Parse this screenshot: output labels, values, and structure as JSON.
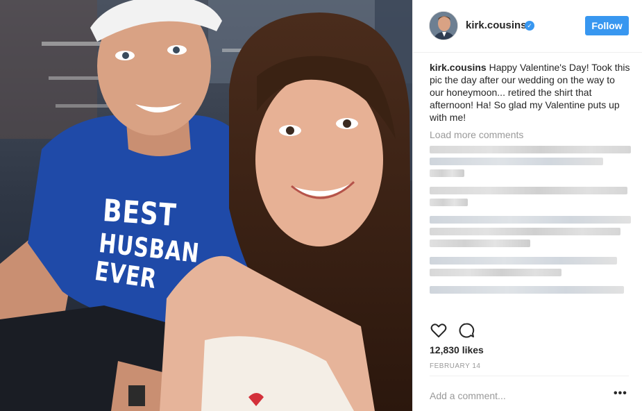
{
  "post": {
    "username": "kirk.cousins",
    "verified_symbol": "✓",
    "follow_label": "Follow",
    "caption_user": "kirk.cousins",
    "caption_text": " Happy Valentine's Day! Took this pic the day after our wedding on the way to our honeymoon... retired the shirt that afternoon! Ha! So glad my Valentine puts up with me!",
    "load_more_label": "Load more comments",
    "likes": "12,830 likes",
    "date": "FEBRUARY 14",
    "comment_placeholder": "Add a comment...",
    "more_options": "•••"
  },
  "photo": {
    "shirt_line_1": "BEST",
    "shirt_line_2": "HUSBAN",
    "shirt_line_3": "EVER"
  },
  "icons": {
    "verified": "verified-badge-icon",
    "like": "heart-icon",
    "comment": "comment-bubble-icon",
    "more": "more-options-icon"
  },
  "colors": {
    "accent": "#3897f0",
    "text": "#262626",
    "muted": "#999999",
    "divider": "#efefef",
    "shirt": "#1f4aa8"
  }
}
